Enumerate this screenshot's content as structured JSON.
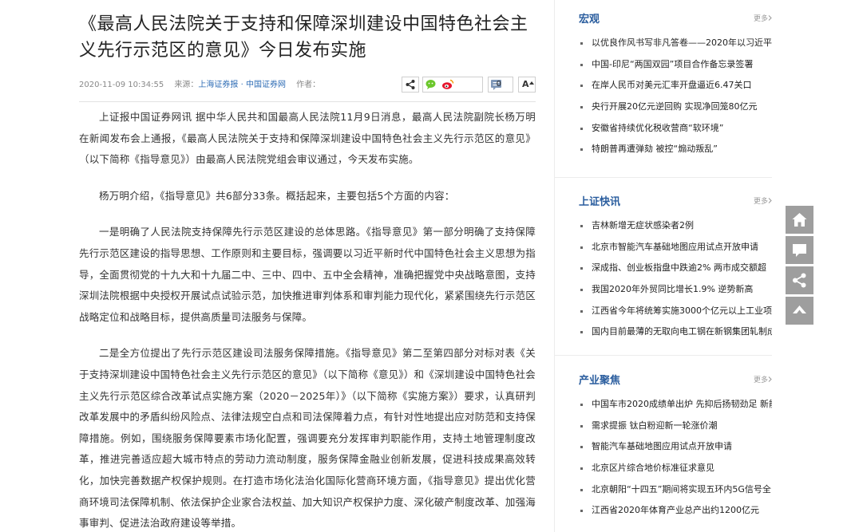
{
  "article": {
    "title": "《最高人民法院关于支持和保障深圳建设中国特色社会主义先行示范区的意见》今日发布实施",
    "date": "2020-11-09 10:34:55",
    "source_label": "来源：",
    "source_link": "上海证券报 · 中国证券网",
    "author_label": "作者：",
    "comment_count": "0",
    "font_toggle": "A",
    "paragraphs": [
      "上证报中国证券网讯 据中华人民共和国最高人民法院11月9日消息，最高人民法院副院长杨万明在新闻发布会上通报，《最高人民法院关于支持和保障深圳建设中国特色社会主义先行示范区的意见》（以下简称《指导意见》）由最高人民法院党组会审议通过，今天发布实施。",
      "杨万明介绍，《指导意见》共6部分33条。概括起来，主要包括5个方面的内容：",
      "一是明确了人民法院支持保障先行示范区建设的总体思路。《指导意见》第一部分明确了支持保障先行示范区建设的指导思想、工作原则和主要目标，强调要以习近平新时代中国特色社会主义思想为指导，全面贯彻党的十九大和十九届二中、三中、四中、五中全会精神，准确把握党中央战略意图，支持深圳法院根据中央授权开展试点试验示范，加快推进审判体系和审判能力现代化，紧紧围绕先行示范区战略定位和战略目标，提供高质量司法服务与保障。",
      "二是全方位提出了先行示范区建设司法服务保障措施。《指导意见》第二至第四部分对标对表《关于支持深圳建设中国特色社会主义先行示范区的意见》（以下简称《意见》）和《深圳建设中国特色社会主义先行示范区综合改革试点实施方案（2020－2025年）》（以下简称《实施方案》）要求，认真研判改革发展中的矛盾纠纷风险点、法律法规空白点和司法保障着力点，有针对性地提出应对防范和支持保障措施。例如，围绕服务保障要素市场化配置，强调要充分发挥审判职能作用，支持土地管理制度改革，推进完善适应超大城市特点的劳动力流动制度，服务保障金融业创新发展，促进科技成果高效转化，加快完善数据产权保护规则。在打造市场化法治化国际化营商环境方面，《指导意见》提出优化营商环境司法保障机制、依法保护企业家合法权益、加大知识产权保护力度、深化破产制度改革、加强海事审判、促进法治政府建设等举措。"
    ]
  },
  "sidebar": {
    "more_label": "更多",
    "sections": [
      {
        "title": "宏观",
        "items": [
          "以优良作风书写非凡答卷——2020年以习近平同",
          "中国-印尼“两国双园”项目合作备忘录签署",
          "在岸人民币对美元汇率开盘逼近6.47关口",
          "央行开展20亿元逆回购 实现净回笼80亿元",
          "安徽省持续优化税收营商“软环境”",
          "特朗普再遭弹劾 被控“煽动叛乱”"
        ]
      },
      {
        "title": "上证快讯",
        "items": [
          "吉林新增无症状感染者2例",
          "北京市智能汽车基础地图应用试点开放申请",
          "深成指、创业板指盘中跌逾2% 两市成交额超",
          "我国2020年外贸同比增长1.9% 逆势新高",
          "江西省今年将统筹实施3000个亿元以上工业项目",
          "国内目前最薄的无取向电工钢在新钢集团轧制成"
        ]
      },
      {
        "title": "产业聚焦",
        "items": [
          "中国车市2020成绩单出炉 先抑后扬韧劲足 新能",
          "需求提振 钛白粉迎新一轮涨价潮",
          "智能汽车基础地图应用试点开放申请",
          "北京区片综合地价标准征求意见",
          "北京朝阳“十四五”期间将实现五环内5G信号全",
          "江西省2020年体育产业总产出约1200亿元"
        ]
      }
    ]
  },
  "float_buttons": [
    "home-icon",
    "comment-icon",
    "share-icon",
    "arrow-up-icon"
  ],
  "colors": {
    "accent": "#2a5d9e",
    "link": "#2e6cb5",
    "float_button": "#9e9e9e"
  }
}
